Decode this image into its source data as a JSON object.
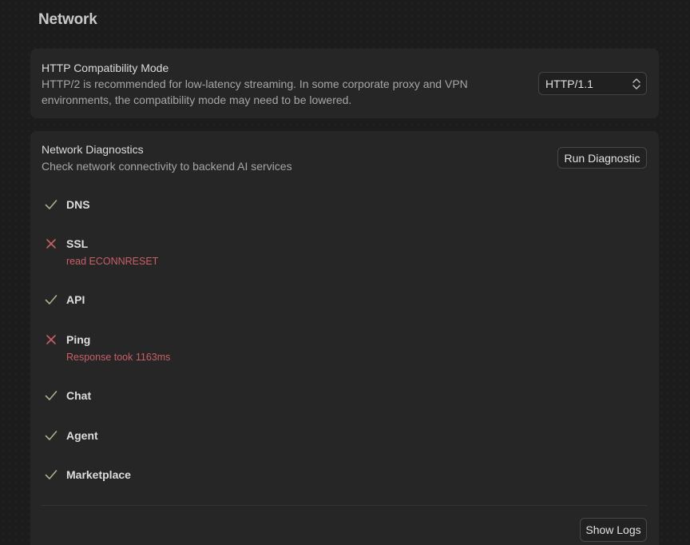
{
  "section": {
    "title": "Network"
  },
  "http_mode": {
    "title": "HTTP Compatibility Mode",
    "description_line1": "HTTP/2 is recommended for low-latency streaming. In some corporate proxy and VPN",
    "description_line2": "environments, the compatibility mode may need to be lowered.",
    "selected": "HTTP/1.1"
  },
  "diagnostics": {
    "title": "Network Diagnostics",
    "description": "Check network connectivity to backend AI services",
    "run_label": "Run Diagnostic",
    "show_logs_label": "Show Logs",
    "checks": [
      {
        "name": "DNS",
        "status": "ok",
        "icon": "check-icon"
      },
      {
        "name": "SSL",
        "status": "error",
        "icon": "x-icon",
        "error": "read ECONNRESET"
      },
      {
        "name": "API",
        "status": "ok",
        "icon": "check-icon"
      },
      {
        "name": "Ping",
        "status": "error",
        "icon": "x-icon",
        "error": "Response took 1163ms"
      },
      {
        "name": "Chat",
        "status": "ok",
        "icon": "check-icon"
      },
      {
        "name": "Agent",
        "status": "ok",
        "icon": "check-icon"
      },
      {
        "name": "Marketplace",
        "status": "ok",
        "icon": "check-icon"
      }
    ]
  },
  "colors": {
    "ok": "#a9b08c",
    "error": "#c95f67",
    "card": "#262626",
    "background": "#1c1c1c"
  }
}
